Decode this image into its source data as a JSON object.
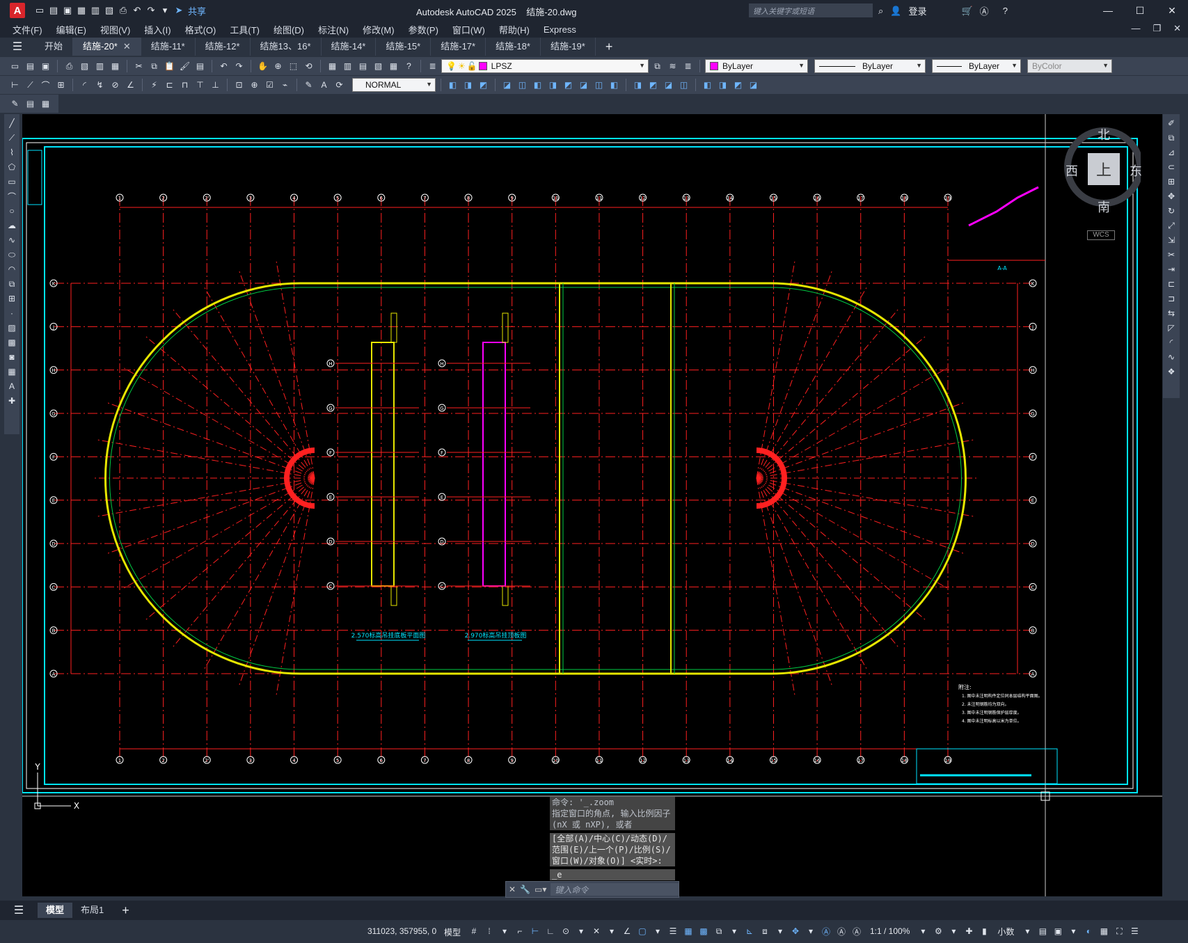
{
  "app": {
    "title": "Autodesk AutoCAD 2025",
    "document": "结施-20.dwg",
    "logo_letter": "A",
    "share_label": "共享",
    "search_placeholder": "键入关键字或短语",
    "signin_label": "登录"
  },
  "menu": [
    "文件(F)",
    "编辑(E)",
    "视图(V)",
    "插入(I)",
    "格式(O)",
    "工具(T)",
    "绘图(D)",
    "标注(N)",
    "修改(M)",
    "参数(P)",
    "窗口(W)",
    "帮助(H)",
    "Express"
  ],
  "file_tabs": [
    {
      "label": "开始",
      "active": false
    },
    {
      "label": "结施-20*",
      "active": true
    },
    {
      "label": "结施-11*",
      "active": false
    },
    {
      "label": "结施-12*",
      "active": false
    },
    {
      "label": "结施13、16*",
      "active": false
    },
    {
      "label": "结施-14*",
      "active": false
    },
    {
      "label": "结施-15*",
      "active": false
    },
    {
      "label": "结施-17*",
      "active": false
    },
    {
      "label": "结施-18*",
      "active": false
    },
    {
      "label": "结施-19*",
      "active": false
    }
  ],
  "properties": {
    "layer": "LPSZ",
    "color": "ByLayer",
    "linetype": "ByLayer",
    "lineweight": "ByLayer",
    "plotstyle": "ByColor",
    "text_style": "NORMAL",
    "color_swatch": "#ff00ff"
  },
  "viewcube": {
    "north": "北",
    "south": "南",
    "east": "东",
    "west": "西",
    "top": "上",
    "wcs": "WCS"
  },
  "drawing": {
    "grid_columns_top": [
      "1",
      "2",
      "2'",
      "3",
      "4",
      "5",
      "6",
      "7",
      "8",
      "9",
      "10",
      "11",
      "12",
      "13",
      "14",
      "15",
      "16",
      "17",
      "18",
      "19"
    ],
    "grid_rows_left": [
      "K",
      "J",
      "H",
      "G",
      "F",
      "E",
      "D",
      "C",
      "B",
      "A"
    ],
    "inner_row_labels": [
      "H",
      "G",
      "F",
      "E",
      "D",
      "C"
    ],
    "plan_title_left": "2.570标高吊挂底板平面图",
    "plan_title_right": "2.970标高吊挂顶板图",
    "section_label": "A-A",
    "notes_title": "附注:",
    "notes": [
      "1. 图中未注明构件定位同本层结构平面图。",
      "2. 未注明钢筋均为双向。",
      "3. 图中未注明钢筋保护层厚度。",
      "4. 图中未注明标高以米为单位。"
    ]
  },
  "command": {
    "history": [
      "命令: '_.zoom",
      "指定窗口的角点, 输入比例因子 (nX 或 nXP), 或者"
    ],
    "options": "[全部(A)/中心(C)/动态(D)/范围(E)/上一个(P)/比例(S)/窗口(W)/对象(O)] <实时>:",
    "cursor": "_e",
    "input_placeholder": "键入命令"
  },
  "layout_tabs": [
    {
      "label": "模型",
      "active": true
    },
    {
      "label": "布局1",
      "active": false
    }
  ],
  "status": {
    "coords": "311023, 357955, 0",
    "mode": "模型",
    "annotation_scale": "1:1 / 100%",
    "units": "小数"
  },
  "colors": {
    "accent_blue": "#6fb6ff",
    "grid_red": "#ff2020",
    "frame_cyan": "#00e5ff",
    "beam_yellow": "#e6e600",
    "beam_green": "#00cc44"
  }
}
